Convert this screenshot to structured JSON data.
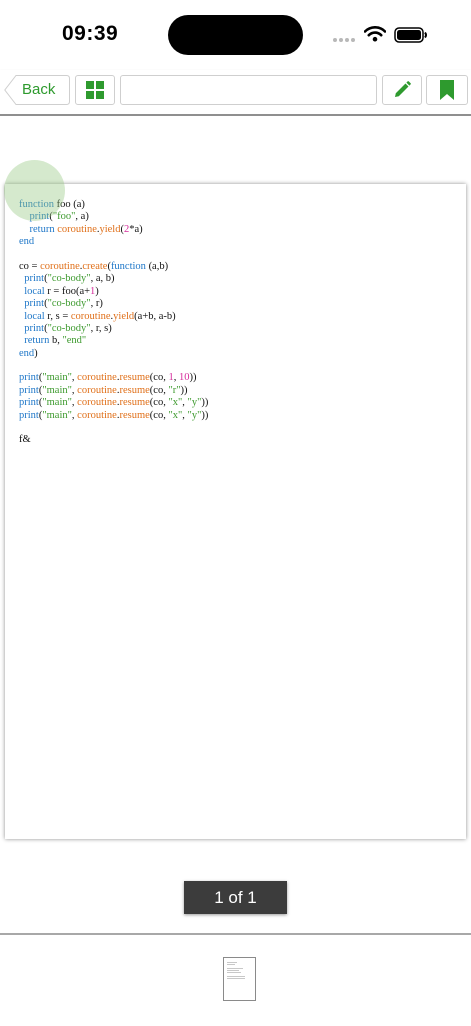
{
  "status_bar": {
    "time": "09:39"
  },
  "toolbar": {
    "back_label": "Back",
    "title_value": "",
    "accent_color": "#2e9a2e"
  },
  "document": {
    "tokens": [
      [
        "function foo (a)"
      ],
      [
        "    print(\"foo\", a)"
      ],
      [
        "    return coroutine.yield(2*a)"
      ],
      [
        "end"
      ],
      [
        ""
      ],
      [
        "co = coroutine.create(function (a,b)"
      ],
      [
        "  print(\"co-body\", a, b)"
      ],
      [
        "  local r = foo(a+1)"
      ],
      [
        "  print(\"co-body\", r)"
      ],
      [
        "  local r, s = coroutine.yield(a+b, a-b)"
      ],
      [
        "  print(\"co-body\", r, s)"
      ],
      [
        "  return b, \"end\""
      ],
      [
        "end)"
      ],
      [
        ""
      ],
      [
        "print(\"main\", coroutine.resume(co, 1, 10))"
      ],
      [
        "print(\"main\", coroutine.resume(co, \"r\"))"
      ],
      [
        "print(\"main\", coroutine.resume(co, \"x\", \"y\"))"
      ],
      [
        "print(\"main\", coroutine.resume(co, \"x\", \"y\"))"
      ],
      [
        ""
      ],
      [
        "f&"
      ]
    ],
    "syntax_colors": {
      "keyword": "#1f77c8",
      "builtin": "#e0701a",
      "string": "#3d9a2e",
      "number": "#d62b9b"
    }
  },
  "pagination": {
    "label": "1 of 1"
  }
}
